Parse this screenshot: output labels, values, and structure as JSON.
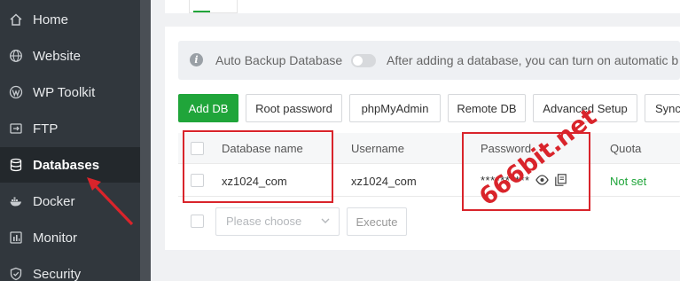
{
  "sidebar": {
    "items": [
      {
        "label": "Home",
        "icon": "home-icon"
      },
      {
        "label": "Website",
        "icon": "globe-icon"
      },
      {
        "label": "WP Toolkit",
        "icon": "wordpress-icon"
      },
      {
        "label": "FTP",
        "icon": "ftp-icon"
      },
      {
        "label": "Databases",
        "icon": "database-icon",
        "active": true
      },
      {
        "label": "Docker",
        "icon": "docker-icon"
      },
      {
        "label": "Monitor",
        "icon": "monitor-icon"
      },
      {
        "label": "Security",
        "icon": "shield-icon"
      }
    ]
  },
  "notice": {
    "label": "Auto Backup Database",
    "text": "After adding a database, you can turn on automatic b"
  },
  "toolbar": {
    "add_db": "Add DB",
    "root_password": "Root password",
    "phpmyadmin": "phpMyAdmin",
    "remote_db": "Remote DB",
    "advanced_setup": "Advanced Setup",
    "sync": "Sync"
  },
  "table": {
    "columns": [
      "Database name",
      "Username",
      "Password",
      "Quota"
    ],
    "rows": [
      {
        "database_name": "xz1024_com",
        "username": "xz1024_com",
        "password": "**********",
        "quota": "Not set"
      }
    ]
  },
  "footer": {
    "select_placeholder": "Please choose",
    "execute": "Execute"
  },
  "annotation": {
    "watermark": "666bit.net"
  },
  "colors": {
    "accent": "#20a53a",
    "sidebar": "#31373d",
    "highlight": "#d9242b"
  }
}
